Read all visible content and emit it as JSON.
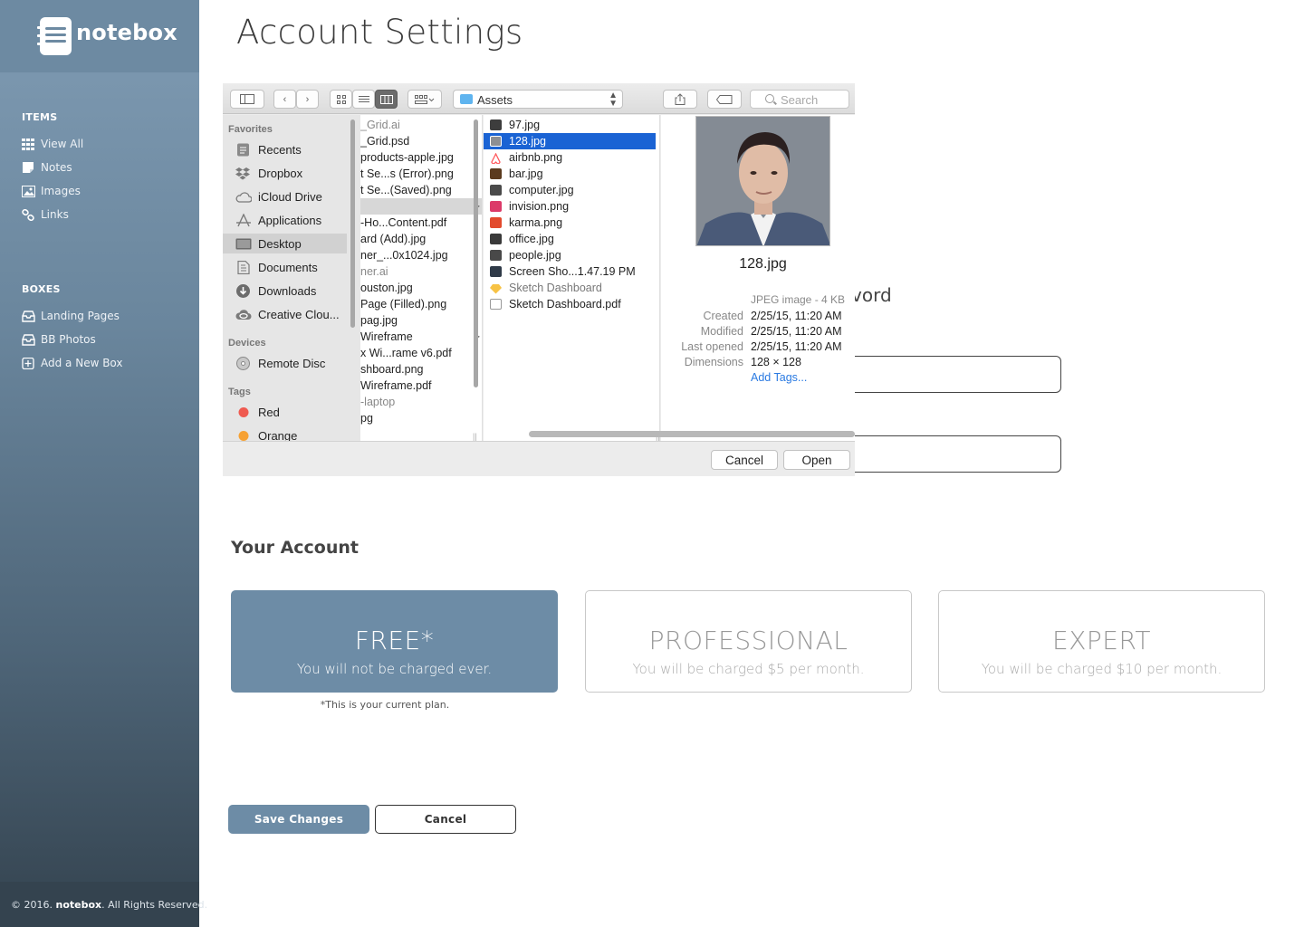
{
  "app": {
    "name": "notebox"
  },
  "sidebar": {
    "items_header": "ITEMS",
    "items": [
      {
        "label": "View All",
        "icon": "grid-icon"
      },
      {
        "label": "Notes",
        "icon": "note-icon"
      },
      {
        "label": "Images",
        "icon": "image-icon"
      },
      {
        "label": "Links",
        "icon": "link-icon"
      }
    ],
    "boxes_header": "BOXES",
    "boxes": [
      {
        "label": "Landing Pages",
        "icon": "inbox-icon"
      },
      {
        "label": "BB Photos",
        "icon": "inbox-icon"
      },
      {
        "label": "Add a New Box",
        "icon": "plus-box-icon"
      }
    ],
    "footer": {
      "prefix": "© 2016.",
      "brand": "notebox",
      "suffix": ". All Rights Reserved."
    }
  },
  "page": {
    "title": "Account Settings"
  },
  "form": {
    "password_label_partial": "vord"
  },
  "account": {
    "section_title": "Your Account",
    "plans": [
      {
        "name": "FREE*",
        "desc": "You will not be charged ever.",
        "active": true
      },
      {
        "name": "PROFESSIONAL",
        "desc": "You will be charged $5 per month.",
        "active": false
      },
      {
        "name": "EXPERT",
        "desc": "You will be charged $10 per month.",
        "active": false
      }
    ],
    "current_note": "*This is your current plan."
  },
  "actions": {
    "save": "Save Changes",
    "cancel": "Cancel"
  },
  "dialog": {
    "location": "Assets",
    "search_placeholder": "Search",
    "favorites_header": "Favorites",
    "favorites": [
      "Recents",
      "Dropbox",
      "iCloud Drive",
      "Applications",
      "Desktop",
      "Documents",
      "Downloads",
      "Creative Clou..."
    ],
    "selected_favorite": "Desktop",
    "devices_header": "Devices",
    "devices": [
      "Remote Disc"
    ],
    "tags_header": "Tags",
    "tags": [
      {
        "name": "Red",
        "color": "#ef5a50"
      },
      {
        "name": "Orange",
        "color": "#f6a133"
      }
    ],
    "column1": [
      {
        "name": "_Grid.ai",
        "dim": true
      },
      {
        "name": "_Grid.psd"
      },
      {
        "name": "products-apple.jpg"
      },
      {
        "name": "t Se...s (Error).png"
      },
      {
        "name": "t Se...(Saved).png"
      },
      {
        "name": "",
        "folder": true,
        "selected": true
      },
      {
        "name": "-Ho...Content.pdf"
      },
      {
        "name": "ard (Add).jpg"
      },
      {
        "name": "ner_...0x1024.jpg"
      },
      {
        "name": "ner.ai",
        "dim": true
      },
      {
        "name": "ouston.jpg"
      },
      {
        "name": "Page (Filled).png"
      },
      {
        "name": "pag.jpg"
      },
      {
        "name": " Wireframe",
        "folder": true
      },
      {
        "name": "x Wi...rame v6.pdf"
      },
      {
        "name": "shboard.png"
      },
      {
        "name": " Wireframe.pdf"
      },
      {
        "name": "-laptop",
        "dim": true
      },
      {
        "name": "pg"
      }
    ],
    "column2": [
      {
        "name": "97.jpg",
        "icon": "photo-file-icon"
      },
      {
        "name": "128.jpg",
        "icon": "photo-file-icon",
        "selected": true
      },
      {
        "name": "airbnb.png",
        "icon": "airbnb-file-icon"
      },
      {
        "name": "bar.jpg",
        "icon": "photo-file-icon"
      },
      {
        "name": "computer.jpg",
        "icon": "photo-file-icon"
      },
      {
        "name": "invision.png",
        "icon": "invision-file-icon"
      },
      {
        "name": "karma.png",
        "icon": "karma-file-icon"
      },
      {
        "name": "office.jpg",
        "icon": "photo-file-icon"
      },
      {
        "name": "people.jpg",
        "icon": "photo-file-icon"
      },
      {
        "name": "Screen Sho...1.47.19 PM",
        "icon": "screenshot-file-icon"
      },
      {
        "name": "Sketch Dashboard",
        "icon": "sketch-file-icon",
        "dim": true
      },
      {
        "name": "Sketch Dashboard.pdf",
        "icon": "pdf-file-icon"
      }
    ],
    "preview": {
      "filename": "128.jpg",
      "kind": "JPEG image - 4 KB",
      "meta": [
        {
          "key": "Created",
          "value": "2/25/15, 11:20 AM"
        },
        {
          "key": "Modified",
          "value": "2/25/15, 11:20 AM"
        },
        {
          "key": "Last opened",
          "value": "2/25/15, 11:20 AM"
        },
        {
          "key": "Dimensions",
          "value": "128 × 128"
        }
      ],
      "add_tags": "Add Tags..."
    },
    "cancel": "Cancel",
    "open": "Open"
  },
  "colors": {
    "accent": "#6d8ca6",
    "selection": "#1a63d4"
  }
}
